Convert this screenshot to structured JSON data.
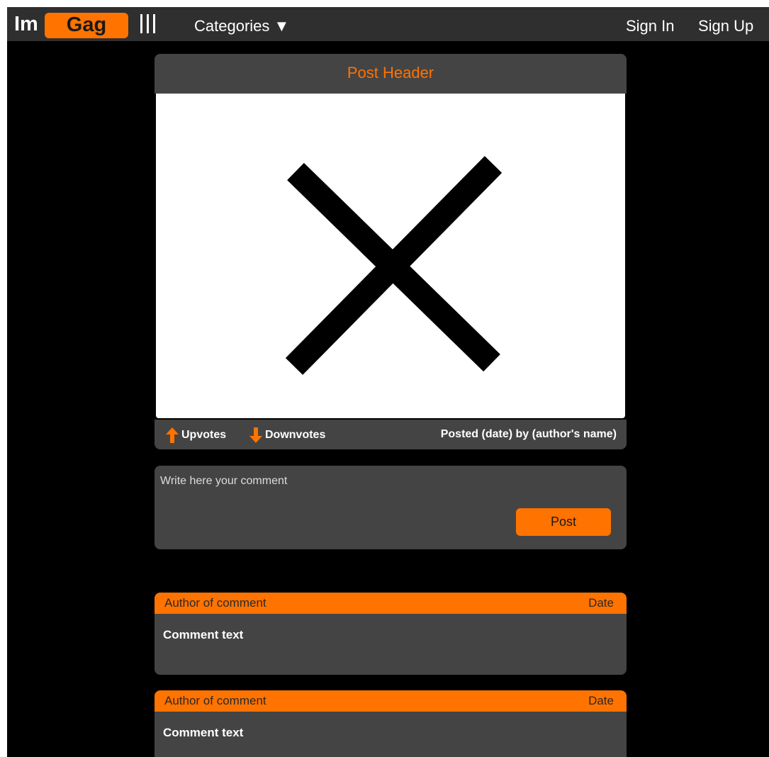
{
  "nav": {
    "logo_left": "Im",
    "logo_right": "Gag",
    "categories_label": "Categories ▼",
    "sign_in_label": "Sign In",
    "sign_up_label": "Sign Up"
  },
  "post": {
    "header": "Post Header",
    "image_icon": "x-placeholder-icon",
    "upvotes_label": "Upvotes",
    "downvotes_label": "Downvotes",
    "posted_by": "Posted (date) by (author's name)"
  },
  "comment_form": {
    "placeholder": "Write here your comment",
    "post_label": "Post"
  },
  "comments": [
    {
      "author": "Author of comment",
      "date": "Date",
      "text": "Comment text"
    },
    {
      "author": "Author of comment",
      "date": "Date",
      "text": "Comment text"
    }
  ],
  "colors": {
    "accent": "#ff7300",
    "panel": "#444444",
    "nav_bg": "#2f2f2f",
    "page_bg": "#000000"
  }
}
